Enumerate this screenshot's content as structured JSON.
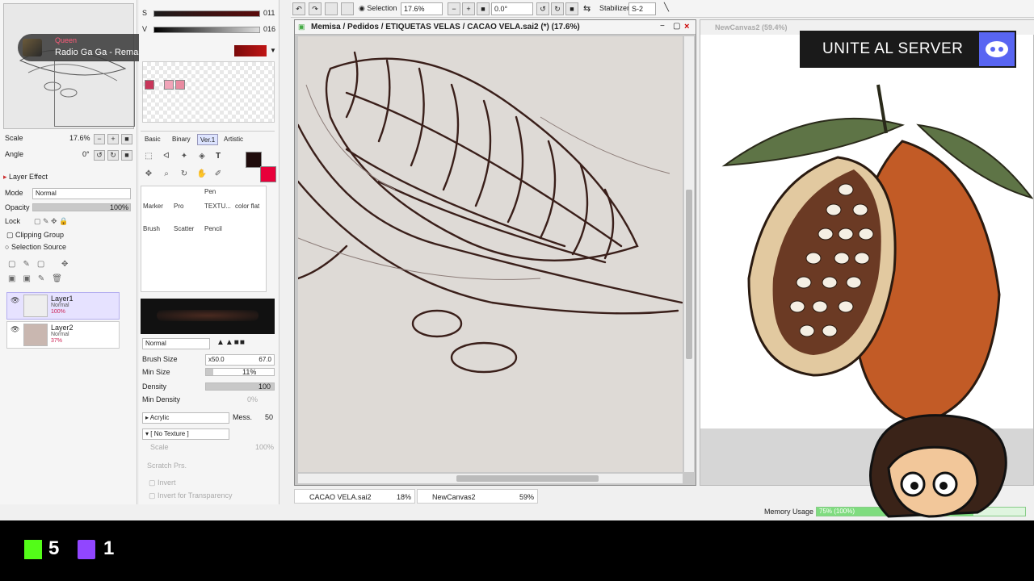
{
  "toast": {
    "source": "Queen",
    "title": "Radio Ga Ga - Remast..."
  },
  "navigator": {
    "scale_label": "Scale",
    "scale_value": "17.6%",
    "angle_label": "Angle",
    "angle_value": "0°"
  },
  "layer_effect": {
    "header": "Layer Effect",
    "mode_label": "Mode",
    "mode_value": "Normal",
    "opacity_label": "Opacity",
    "opacity_value": "100%",
    "lock_label": "Lock",
    "clipping": "Clipping Group",
    "selection_source": "Selection Source"
  },
  "layers": [
    {
      "name": "Layer1",
      "mode": "Normal",
      "opacity": "100%"
    },
    {
      "name": "Layer2",
      "mode": "Normal",
      "opacity": "37%"
    }
  ],
  "color": {
    "s_label": "S",
    "s_value": "011",
    "v_label": "V",
    "v_value": "016",
    "primary": "#1f0c0c",
    "secondary": "#e8003a"
  },
  "tool_tabs": [
    "Basic",
    "Binary",
    "Ver.1",
    "Artistic"
  ],
  "brushes": {
    "row1": [
      "",
      "",
      "Pen",
      "",
      ""
    ],
    "row2": [
      "Marker",
      "Pro",
      "TEXTU...",
      "color flat"
    ],
    "row3": [
      "Brush",
      "Scatter",
      "Pencil"
    ]
  },
  "brush_settings": {
    "blend": "Normal",
    "size_label": "Brush Size",
    "size_mult": "x50.0",
    "size_value": "67.0",
    "minsize_label": "Min Size",
    "minsize_value": "11%",
    "density_label": "Density",
    "density_value": "100",
    "mindensity_label": "Min Density",
    "mindensity_value": "0%",
    "texture_type": "Acrylic",
    "mess_label": "Mess.",
    "mess_value": "50",
    "texture": "[ No Texture ]",
    "scale_label": "Scale",
    "scale_value": "100%",
    "scratch_label": "Scratch Prs.",
    "invert": "Invert",
    "invert_transp": "Invert for Transparency"
  },
  "toolbar": {
    "selection_label": "Selection",
    "zoom": "17.6%",
    "angle": "0.0°",
    "stabilizer_label": "Stabilizer",
    "stabilizer_value": "S-2"
  },
  "canvas": {
    "title": "Memisa / Pedidos / ETIQUETAS VELAS / CACAO VELA.sai2 (*) (17.6%)"
  },
  "canvas2": {
    "title": "NewCanvas2 (59.4%)"
  },
  "overlay": {
    "server_text": "UNITE AL SERVER"
  },
  "status": {
    "tabs": [
      {
        "name": "CACAO VELA.sai2",
        "zoom": "18%"
      },
      {
        "name": "NewCanvas2",
        "zoom": "59%"
      }
    ],
    "memory_label": "Memory Usage",
    "memory_value": "75% (100%)"
  },
  "stream": {
    "kick_count": "5",
    "twitch_count": "1"
  }
}
